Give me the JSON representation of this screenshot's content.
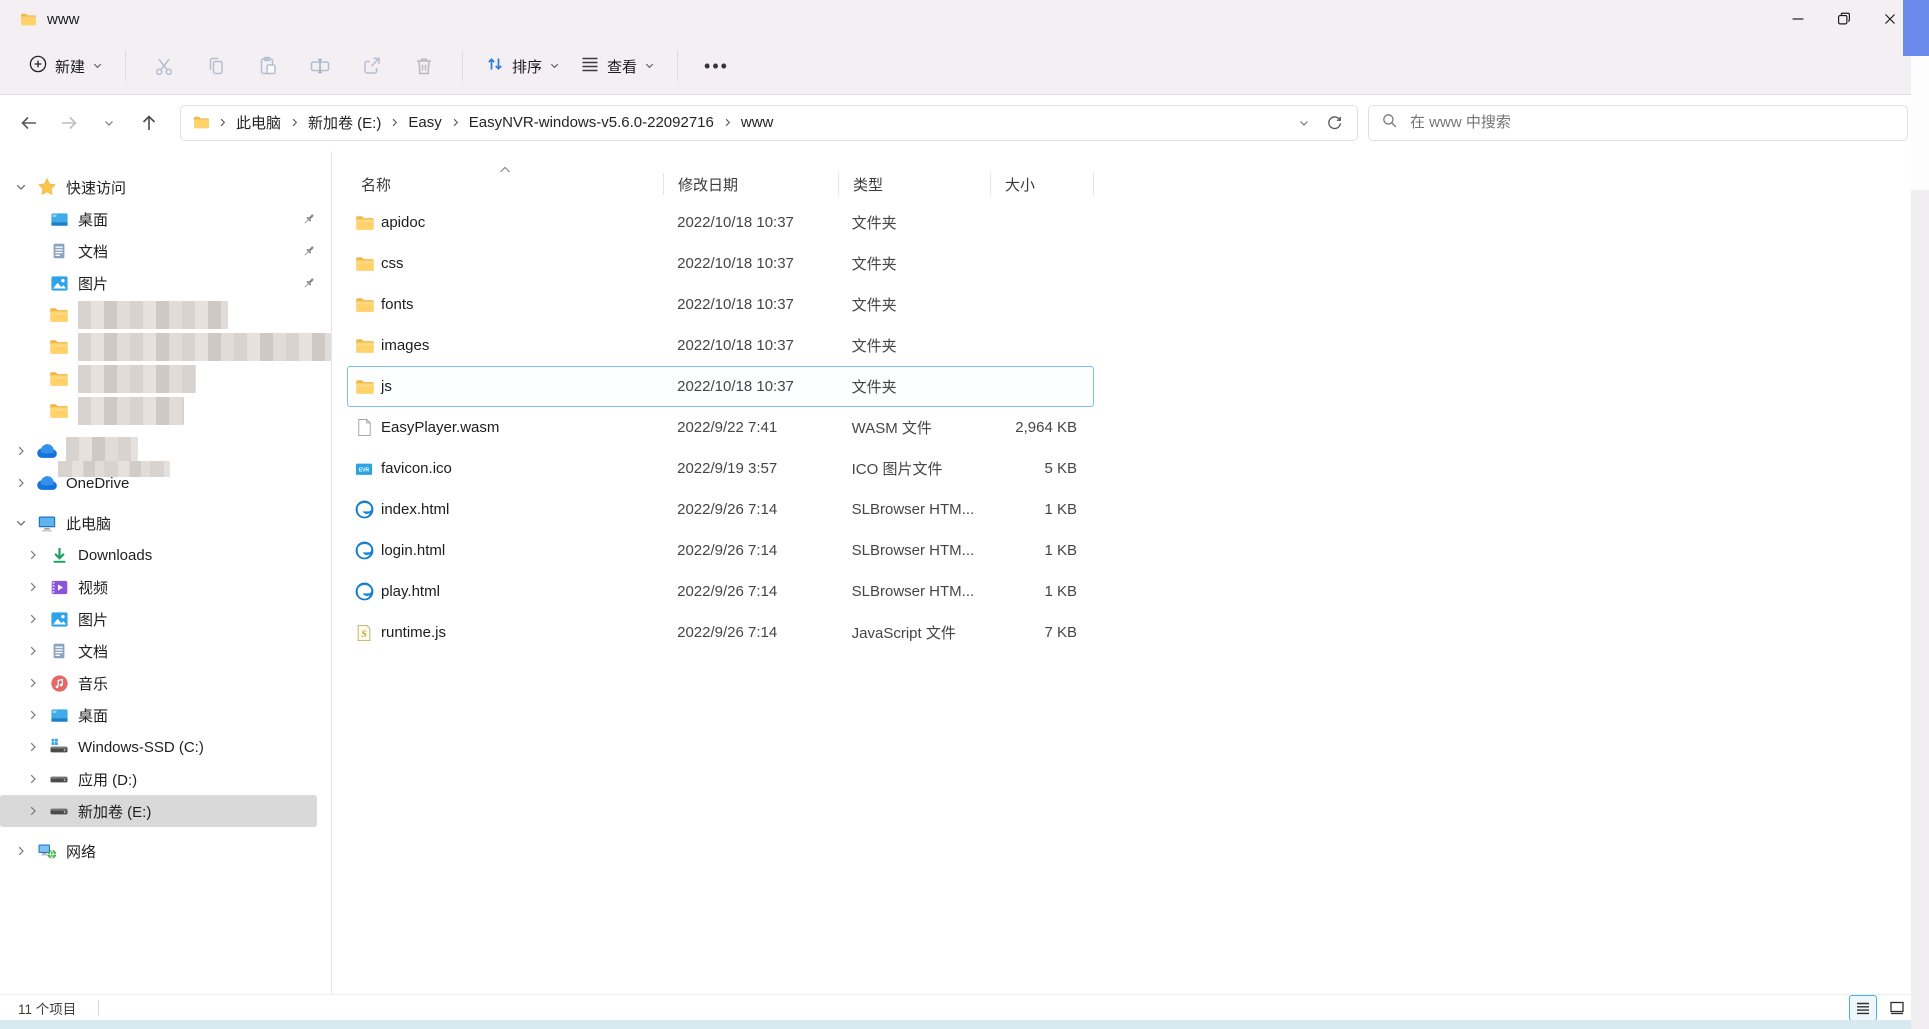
{
  "window": {
    "title": "www"
  },
  "toolbar": {
    "new_label": "新建",
    "sort_label": "排序",
    "view_label": "查看",
    "more_label": "•••"
  },
  "addressbar": {
    "breadcrumbs": [
      "此电脑",
      "新加卷 (E:)",
      "Easy",
      "EasyNVR-windows-v5.6.0-22092716",
      "www"
    ],
    "search_placeholder": "在 www 中搜索"
  },
  "sidebar": {
    "items": [
      {
        "id": "quick-access",
        "label": "快速访问",
        "icon": "star",
        "expander": "down",
        "level": 0
      },
      {
        "id": "desktop-pinned",
        "label": "桌面",
        "icon": "desktop",
        "level": 1,
        "pinned": true
      },
      {
        "id": "documents-pinned",
        "label": "文档",
        "icon": "document",
        "level": 1,
        "pinned": true
      },
      {
        "id": "pictures-pinned",
        "label": "图片",
        "icon": "picture",
        "level": 1,
        "pinned": true
      },
      {
        "id": "folder-redacted-1",
        "label": "",
        "icon": "folder",
        "level": 1,
        "blur_width": 150
      },
      {
        "id": "folder-redacted-2",
        "label": "",
        "icon": "folder",
        "level": 1,
        "blur_width": 268
      },
      {
        "id": "folder-redacted-3",
        "label": "",
        "icon": "folder",
        "level": 1,
        "blur_width": 118
      },
      {
        "id": "folder-redacted-4",
        "label": "",
        "icon": "folder",
        "level": 1,
        "blur_width": 106
      },
      {
        "id": "cloud-redacted",
        "label": "",
        "icon": "cloud",
        "expander": "right",
        "level": 0,
        "gap_before": true,
        "blur_width": 72
      },
      {
        "id": "onedrive",
        "label": "OneDrive",
        "icon": "cloud",
        "expander": "right",
        "level": 0
      },
      {
        "id": "this-pc",
        "label": "此电脑",
        "icon": "computer",
        "expander": "down",
        "level": 0,
        "gap_before": true
      },
      {
        "id": "downloads",
        "label": "Downloads",
        "icon": "downloads",
        "expander": "right",
        "level": 1
      },
      {
        "id": "videos",
        "label": "视频",
        "icon": "videos",
        "expander": "right",
        "level": 1
      },
      {
        "id": "pictures",
        "label": "图片",
        "icon": "picture",
        "expander": "right",
        "level": 1
      },
      {
        "id": "documents",
        "label": "文档",
        "icon": "document",
        "expander": "right",
        "level": 1
      },
      {
        "id": "music",
        "label": "音乐",
        "icon": "music",
        "expander": "right",
        "level": 1
      },
      {
        "id": "desktop",
        "label": "桌面",
        "icon": "desktop",
        "expander": "right",
        "level": 1
      },
      {
        "id": "drive-c",
        "label": "Windows-SSD (C:)",
        "icon": "drive-win",
        "expander": "right",
        "level": 1
      },
      {
        "id": "drive-d",
        "label": "应用 (D:)",
        "icon": "drive",
        "expander": "right",
        "level": 1
      },
      {
        "id": "drive-e",
        "label": "新加卷 (E:)",
        "icon": "drive",
        "expander": "right",
        "level": 1,
        "selected": true
      },
      {
        "id": "network",
        "label": "网络",
        "icon": "network",
        "expander": "right",
        "level": 0,
        "gap_before": true
      }
    ]
  },
  "files": {
    "columns": [
      "名称",
      "修改日期",
      "类型",
      "大小"
    ],
    "sort_column": "名称",
    "rows": [
      {
        "name": "apidoc",
        "date": "2022/10/18 10:37",
        "type": "文件夹",
        "size": "",
        "icon": "folder"
      },
      {
        "name": "css",
        "date": "2022/10/18 10:37",
        "type": "文件夹",
        "size": "",
        "icon": "folder"
      },
      {
        "name": "fonts",
        "date": "2022/10/18 10:37",
        "type": "文件夹",
        "size": "",
        "icon": "folder"
      },
      {
        "name": "images",
        "date": "2022/10/18 10:37",
        "type": "文件夹",
        "size": "",
        "icon": "folder"
      },
      {
        "name": "js",
        "date": "2022/10/18 10:37",
        "type": "文件夹",
        "size": "",
        "icon": "folder",
        "selected": true
      },
      {
        "name": "EasyPlayer.wasm",
        "date": "2022/9/22 7:41",
        "type": "WASM 文件",
        "size": "2,964 KB",
        "icon": "file-wasm"
      },
      {
        "name": "favicon.ico",
        "date": "2022/9/19 3:57",
        "type": "ICO 图片文件",
        "size": "5 KB",
        "icon": "file-ico"
      },
      {
        "name": "index.html",
        "date": "2022/9/26 7:14",
        "type": "SLBrowser HTM...",
        "size": "1 KB",
        "icon": "file-html"
      },
      {
        "name": "login.html",
        "date": "2022/9/26 7:14",
        "type": "SLBrowser HTM...",
        "size": "1 KB",
        "icon": "file-html"
      },
      {
        "name": "play.html",
        "date": "2022/9/26 7:14",
        "type": "SLBrowser HTM...",
        "size": "1 KB",
        "icon": "file-html"
      },
      {
        "name": "runtime.js",
        "date": "2022/9/26 7:14",
        "type": "JavaScript 文件",
        "size": "7 KB",
        "icon": "file-js"
      }
    ]
  },
  "statusbar": {
    "items_count": "11 个项目"
  },
  "colors": {
    "accent_blue": "#2b7cd4",
    "selection_border": "#7cc0f0",
    "mica_background": "#f3eff2",
    "sidebar_selected": "#d9d9d9",
    "bottom_strip": "#d8eaf0"
  }
}
